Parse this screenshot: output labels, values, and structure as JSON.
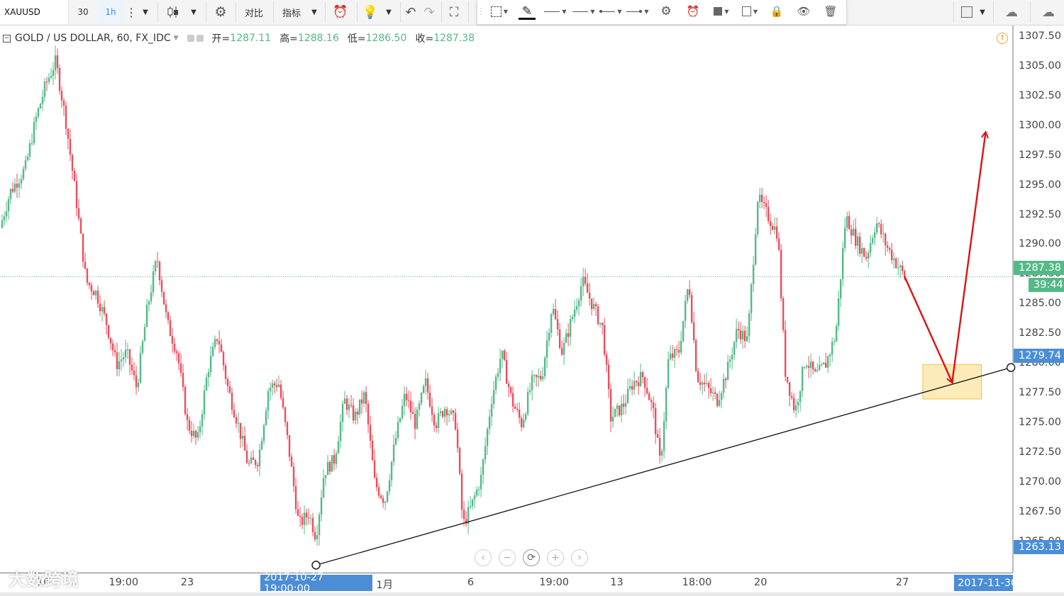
{
  "toolbar": {
    "symbol": "XAUUSD",
    "interval_30": "30",
    "interval_1h": "1h",
    "compare_label": "对比",
    "indicators_label": "指标"
  },
  "legend": {
    "title": "GOLD / US DOLLAR, 60, FX_IDC",
    "open_key": "开=",
    "open_val": "1287.11",
    "high_key": "高=",
    "high_val": "1288.16",
    "low_key": "低=",
    "low_val": "1286.50",
    "close_key": "收=",
    "close_val": "1287.38"
  },
  "labels": {
    "last_price": "1287.38",
    "countdown": "39:44",
    "trend_price": "1279.74",
    "anchor_price": "1263.13",
    "x_start_date": "2017-10-27 19:00:00",
    "x_end_date": "2017-11-30"
  },
  "watermark": "大数跨境",
  "colors": {
    "up": "#53b987",
    "down": "#eb4d5c",
    "arrow": "#e01010",
    "price_label": "#53b987",
    "trend_label": "#4b8ed6",
    "target_zone": "#fbe3a0"
  },
  "chart_data": {
    "type": "candlestick",
    "symbol": "GOLD / US DOLLAR",
    "timeframe": "60",
    "ylim": [
      1262.5,
      1308.5
    ],
    "y_ticks": [
      "1307.50",
      "1305.00",
      "1302.50",
      "1300.00",
      "1297.50",
      "1295.00",
      "1292.50",
      "1290.00",
      "1287.50",
      "1285.00",
      "1282.50",
      "1280.00",
      "1277.50",
      "1275.00",
      "1272.50",
      "1270.00",
      "1267.50",
      "1265.00"
    ],
    "x_ticks": [
      "16",
      "19:00",
      "23",
      "1月",
      "6",
      "19:00",
      "13",
      "18:00",
      "20",
      "27"
    ],
    "last_price": 1287.38,
    "close_path": [
      {
        "x": 0,
        "y": 1291.5
      },
      {
        "x": 0.01,
        "y": 1294.5
      },
      {
        "x": 0.025,
        "y": 1296.5
      },
      {
        "x": 0.035,
        "y": 1300.5
      },
      {
        "x": 0.045,
        "y": 1303.5
      },
      {
        "x": 0.055,
        "y": 1305.5
      },
      {
        "x": 0.065,
        "y": 1300.5
      },
      {
        "x": 0.075,
        "y": 1294.0
      },
      {
        "x": 0.085,
        "y": 1287.0
      },
      {
        "x": 0.095,
        "y": 1286.0
      },
      {
        "x": 0.105,
        "y": 1283.5
      },
      {
        "x": 0.115,
        "y": 1280.0
      },
      {
        "x": 0.125,
        "y": 1281.0
      },
      {
        "x": 0.135,
        "y": 1278.0
      },
      {
        "x": 0.145,
        "y": 1284.5
      },
      {
        "x": 0.155,
        "y": 1289.0
      },
      {
        "x": 0.165,
        "y": 1283.5
      },
      {
        "x": 0.175,
        "y": 1281.0
      },
      {
        "x": 0.185,
        "y": 1275.0
      },
      {
        "x": 0.195,
        "y": 1273.5
      },
      {
        "x": 0.205,
        "y": 1279.5
      },
      {
        "x": 0.215,
        "y": 1282.5
      },
      {
        "x": 0.225,
        "y": 1278.0
      },
      {
        "x": 0.235,
        "y": 1275.0
      },
      {
        "x": 0.245,
        "y": 1271.5
      },
      {
        "x": 0.255,
        "y": 1272.0
      },
      {
        "x": 0.265,
        "y": 1278.0
      },
      {
        "x": 0.275,
        "y": 1278.5
      },
      {
        "x": 0.285,
        "y": 1273.0
      },
      {
        "x": 0.295,
        "y": 1266.5
      },
      {
        "x": 0.305,
        "y": 1267.5
      },
      {
        "x": 0.312,
        "y": 1265.5
      },
      {
        "x": 0.32,
        "y": 1271.0
      },
      {
        "x": 0.33,
        "y": 1272.0
      },
      {
        "x": 0.34,
        "y": 1277.0
      },
      {
        "x": 0.35,
        "y": 1275.5
      },
      {
        "x": 0.36,
        "y": 1277.5
      },
      {
        "x": 0.37,
        "y": 1270.0
      },
      {
        "x": 0.38,
        "y": 1268.5
      },
      {
        "x": 0.39,
        "y": 1273.5
      },
      {
        "x": 0.4,
        "y": 1277.5
      },
      {
        "x": 0.41,
        "y": 1275.0
      },
      {
        "x": 0.42,
        "y": 1278.5
      },
      {
        "x": 0.43,
        "y": 1275.0
      },
      {
        "x": 0.44,
        "y": 1276.5
      },
      {
        "x": 0.45,
        "y": 1275.0
      },
      {
        "x": 0.457,
        "y": 1266.5
      },
      {
        "x": 0.465,
        "y": 1268.0
      },
      {
        "x": 0.475,
        "y": 1270.5
      },
      {
        "x": 0.485,
        "y": 1277.0
      },
      {
        "x": 0.495,
        "y": 1281.0
      },
      {
        "x": 0.505,
        "y": 1277.0
      },
      {
        "x": 0.515,
        "y": 1275.0
      },
      {
        "x": 0.525,
        "y": 1278.5
      },
      {
        "x": 0.535,
        "y": 1279.0
      },
      {
        "x": 0.545,
        "y": 1285.0
      },
      {
        "x": 0.555,
        "y": 1281.0
      },
      {
        "x": 0.565,
        "y": 1284.0
      },
      {
        "x": 0.575,
        "y": 1287.0
      },
      {
        "x": 0.585,
        "y": 1285.0
      },
      {
        "x": 0.595,
        "y": 1283.0
      },
      {
        "x": 0.603,
        "y": 1275.5
      },
      {
        "x": 0.615,
        "y": 1276.5
      },
      {
        "x": 0.625,
        "y": 1278.5
      },
      {
        "x": 0.635,
        "y": 1279.0
      },
      {
        "x": 0.645,
        "y": 1276.0
      },
      {
        "x": 0.652,
        "y": 1271.5
      },
      {
        "x": 0.66,
        "y": 1280.5
      },
      {
        "x": 0.67,
        "y": 1281.0
      },
      {
        "x": 0.68,
        "y": 1287.0
      },
      {
        "x": 0.688,
        "y": 1279.0
      },
      {
        "x": 0.698,
        "y": 1278.0
      },
      {
        "x": 0.708,
        "y": 1277.0
      },
      {
        "x": 0.718,
        "y": 1279.5
      },
      {
        "x": 0.728,
        "y": 1283.0
      },
      {
        "x": 0.738,
        "y": 1282.0
      },
      {
        "x": 0.748,
        "y": 1294.0
      },
      {
        "x": 0.758,
        "y": 1292.5
      },
      {
        "x": 0.768,
        "y": 1291.0
      },
      {
        "x": 0.775,
        "y": 1279.5
      },
      {
        "x": 0.785,
        "y": 1276.0
      },
      {
        "x": 0.795,
        "y": 1280.5
      },
      {
        "x": 0.805,
        "y": 1279.0
      },
      {
        "x": 0.815,
        "y": 1280.0
      },
      {
        "x": 0.825,
        "y": 1282.5
      },
      {
        "x": 0.835,
        "y": 1292.5
      },
      {
        "x": 0.845,
        "y": 1290.5
      },
      {
        "x": 0.855,
        "y": 1289.0
      },
      {
        "x": 0.865,
        "y": 1292.0
      },
      {
        "x": 0.875,
        "y": 1290.0
      },
      {
        "x": 0.885,
        "y": 1288.5
      },
      {
        "x": 0.893,
        "y": 1287.4
      }
    ],
    "annotations": {
      "trendline": [
        {
          "x": 0.312,
          "y": 1263.13
        },
        {
          "x": 0.998,
          "y": 1279.74
        }
      ],
      "projection_arrows": [
        {
          "from": {
            "x": 0.893,
            "y": 1287.4
          },
          "to": {
            "x": 0.94,
            "y": 1278.5
          }
        },
        {
          "from": {
            "x": 0.94,
            "y": 1278.5
          },
          "to": {
            "x": 0.973,
            "y": 1299.5
          }
        }
      ],
      "target_zone": {
        "x0": 0.911,
        "x1": 0.969,
        "y0": 1277.1,
        "y1": 1280.0
      }
    }
  }
}
